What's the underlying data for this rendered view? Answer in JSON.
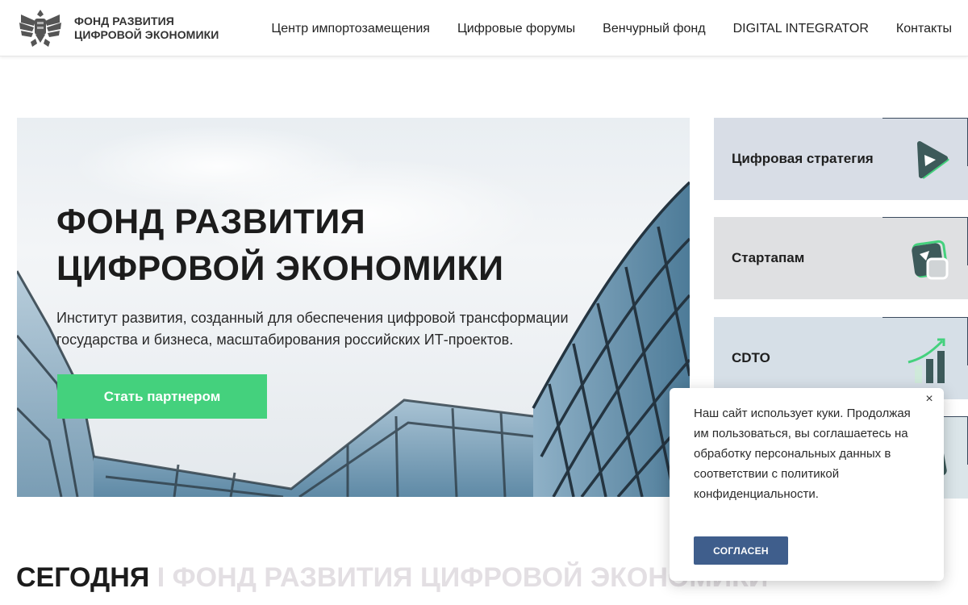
{
  "header": {
    "logo_line1": "ФОНД РАЗВИТИЯ",
    "logo_line2": "ЦИФРОВОЙ ЭКОНОМИКИ",
    "nav": [
      "Центр импортозамещения",
      "Цифровые форумы",
      "Венчурный фонд",
      "DIGITAL INTEGRATOR",
      "Контакты"
    ]
  },
  "hero": {
    "title_line1": "ФОНД РАЗВИТИЯ",
    "title_line2": "ЦИФРОВОЙ ЭКОНОМИКИ",
    "description": "Институт развития, созданный для обеспечения цифровой трансформации государства и бизнеса, масштабирования российских ИТ-проектов.",
    "button": "Стать партнером"
  },
  "cards": [
    {
      "label": "Цифровая стратегия",
      "icon": "triangle-icon",
      "bg": "#d8dde6"
    },
    {
      "label": "Стартапам",
      "icon": "startup-cards-icon",
      "bg": "#dfe0e2"
    },
    {
      "label": "CDTO",
      "icon": "growth-chart-icon",
      "bg": "#d6dfe7"
    },
    {
      "label": "",
      "icon": "card-icon",
      "bg": "#dbe5e9"
    }
  ],
  "section": {
    "title_dark": "СЕГОДНЯ",
    "title_light": "I ФОНД РАЗВИТИЯ ЦИФРОВОЙ ЭКОНОМИКИ"
  },
  "cookie": {
    "text": "Наш сайт использует куки. Продолжая им пользоваться, вы соглашаетесь на обработку персональных данных в соответствии с политикой конфиденциальности.",
    "button": "СОГЛАСЕН",
    "close": "×"
  },
  "colors": {
    "accent_green": "#44d17d",
    "cookie_button": "#3f5e8c",
    "icon_dark": "#3d5a5a"
  }
}
